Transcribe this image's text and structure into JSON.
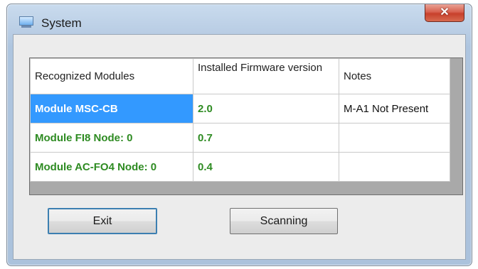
{
  "window": {
    "title": "System"
  },
  "table": {
    "headers": [
      "Recognized Modules",
      "Installed Firmware version",
      "Notes"
    ],
    "rows": [
      {
        "module": "Module MSC-CB",
        "firmware": "2.0",
        "notes": "M-A1 Not Present",
        "selected": true
      },
      {
        "module": "Module FI8 Node: 0",
        "firmware": "0.7",
        "notes": "",
        "selected": false
      },
      {
        "module": "Module AC-FO4 Node: 0",
        "firmware": "0.4",
        "notes": "",
        "selected": false
      }
    ]
  },
  "buttons": {
    "exit": "Exit",
    "scanning": "Scanning"
  },
  "icons": {
    "app": "monitor-icon",
    "close": "close-icon"
  },
  "colors": {
    "selection": "#3399ff",
    "module_text": "#2e8b22",
    "close_button": "#c7402c"
  }
}
